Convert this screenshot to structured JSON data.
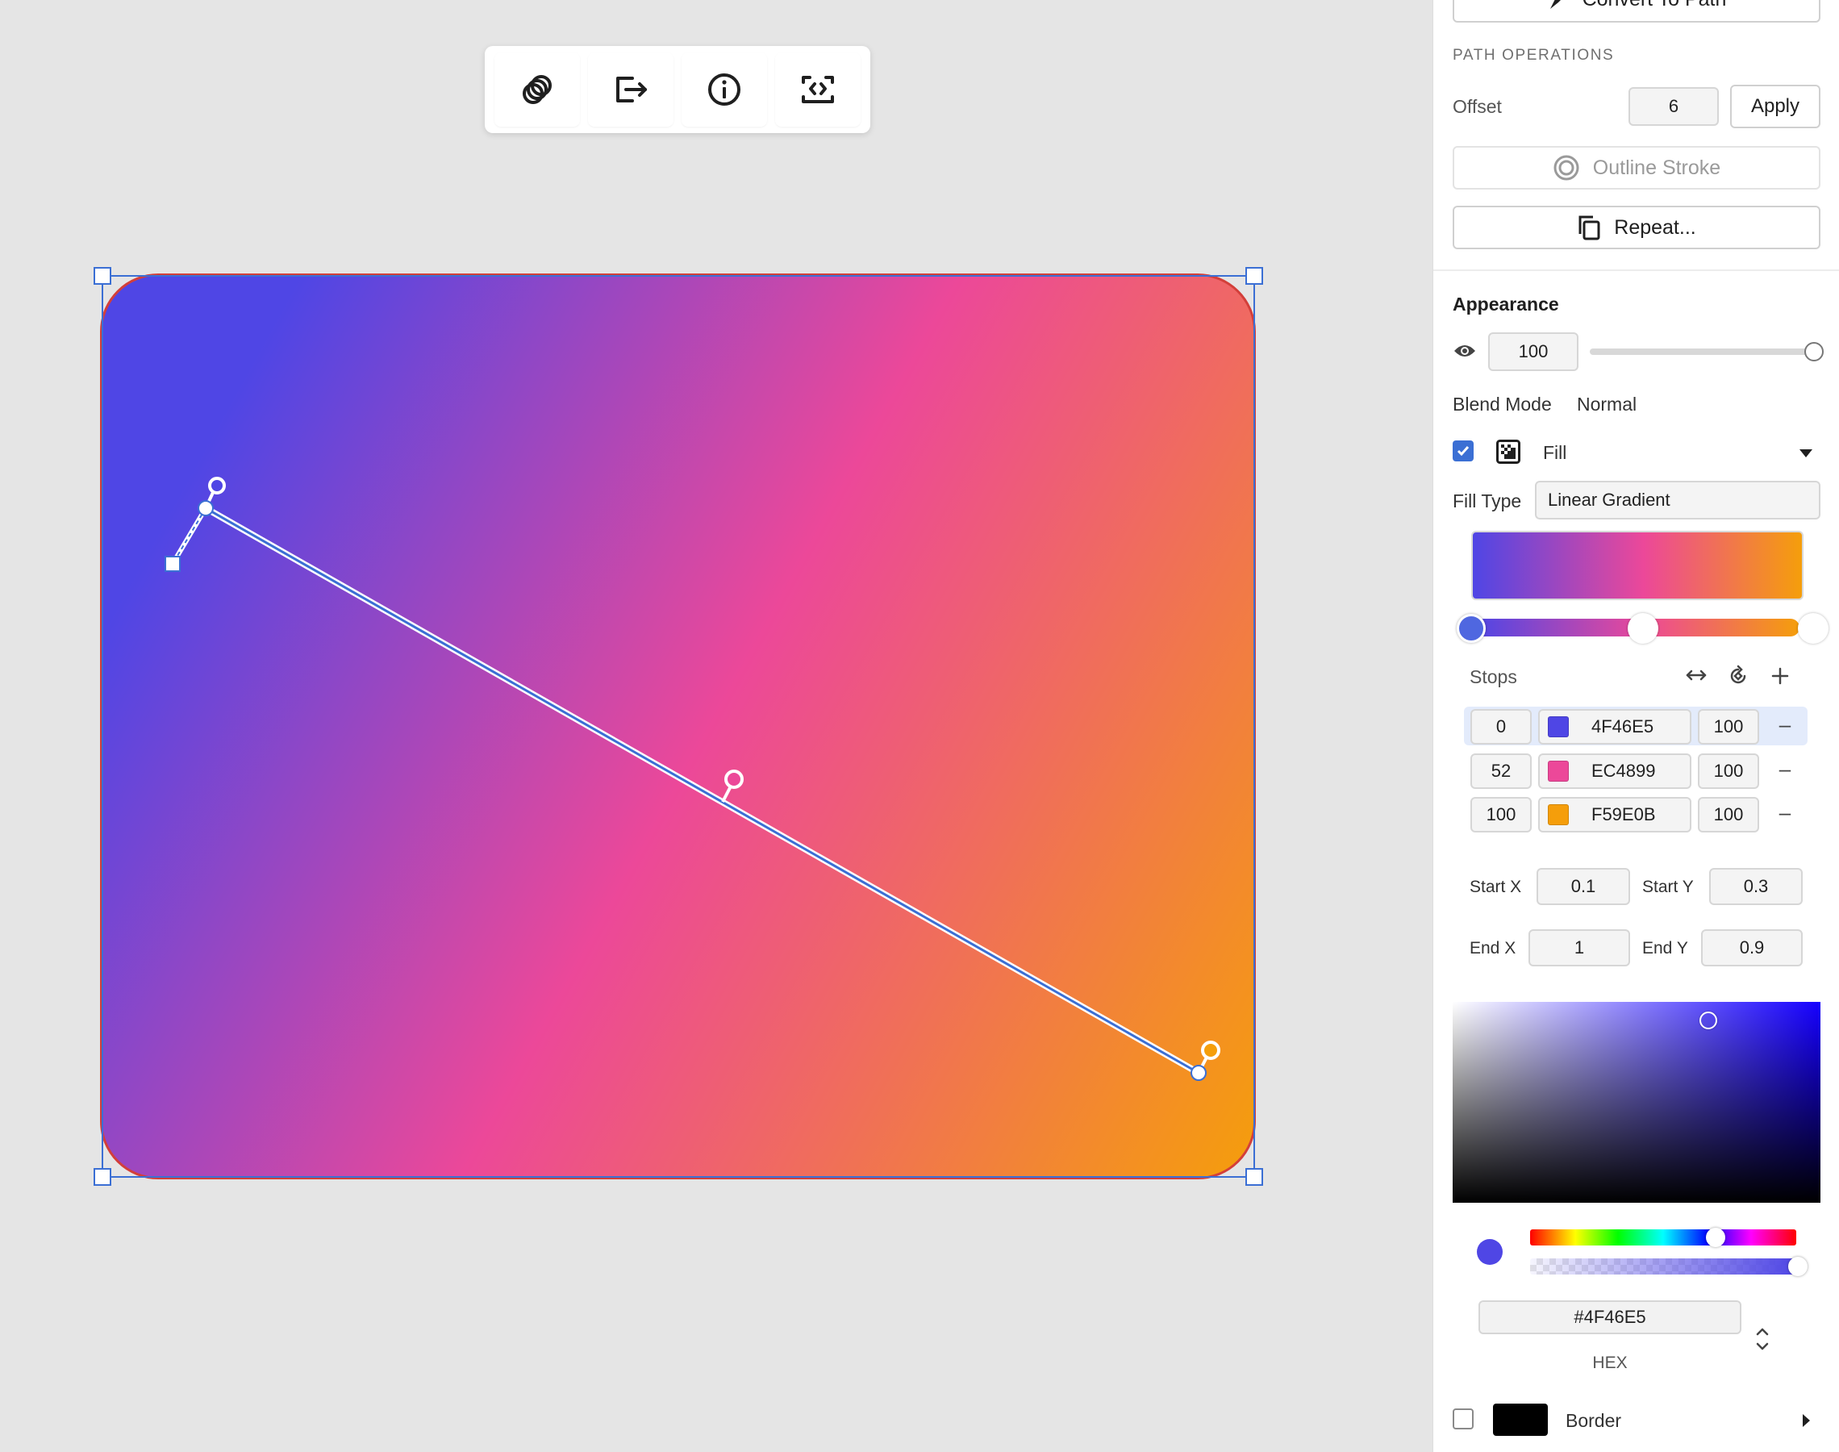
{
  "toolbar": {
    "icons": [
      "intersect-icon",
      "export-icon",
      "info-icon",
      "embed-code-icon"
    ]
  },
  "panel": {
    "convert_label": "Convert To Path",
    "path_operations": {
      "title": "PATH OPERATIONS",
      "offset_label": "Offset",
      "offset_value": "6",
      "apply_label": "Apply",
      "outline_stroke_label": "Outline Stroke",
      "repeat_label": "Repeat..."
    },
    "appearance": {
      "title": "Appearance",
      "opacity_value": "100",
      "opacity_percent": 100,
      "blend_mode_label": "Blend Mode",
      "blend_mode_value": "Normal"
    },
    "fill": {
      "enabled": true,
      "label": "Fill",
      "fill_type_label": "Fill Type",
      "fill_type_value": "Linear Gradient",
      "stops_label": "Stops",
      "stops": [
        {
          "position": "0",
          "hex": "4F46E5",
          "color": "#4F46E5",
          "opacity": "100"
        },
        {
          "position": "52",
          "hex": "EC4899",
          "color": "#EC4899",
          "opacity": "100"
        },
        {
          "position": "100",
          "hex": "F59E0B",
          "color": "#F59E0B",
          "opacity": "100"
        }
      ],
      "start_x_label": "Start X",
      "start_x": "0.1",
      "start_y_label": "Start Y",
      "start_y": "0.3",
      "end_x_label": "End X",
      "end_x": "1",
      "end_y_label": "End Y",
      "end_y": "0.9"
    },
    "color_picker": {
      "hex_value": "#4F46E5",
      "format_label": "HEX",
      "hue_color": "#1500ff",
      "current_color": "#4F46E5"
    },
    "border": {
      "enabled": false,
      "label": "Border",
      "color": "#000000"
    }
  },
  "colors": {
    "accent": "#3b6fd4",
    "gradient_start": "#4F46E5",
    "gradient_mid": "#EC4899",
    "gradient_end": "#F59E0B"
  }
}
